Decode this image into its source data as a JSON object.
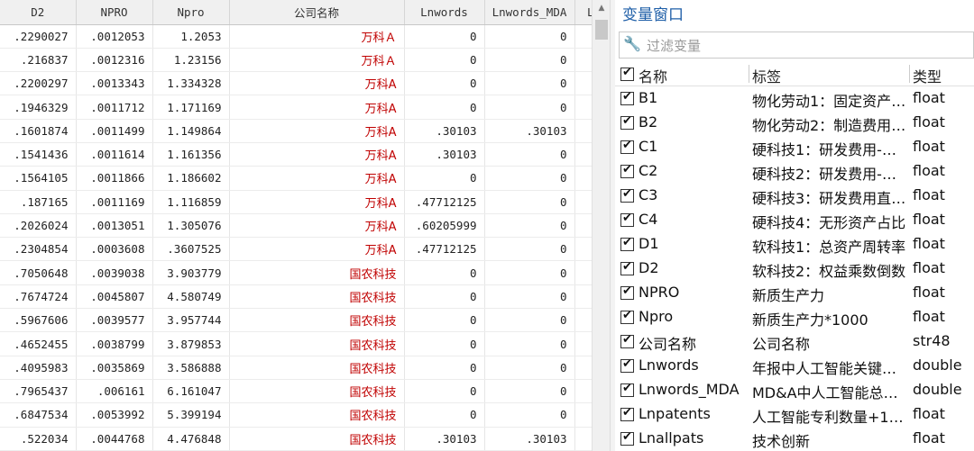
{
  "grid": {
    "columns": [
      "D2",
      "NPRO",
      "Npro",
      "公司名称",
      "Lnwords",
      "Lnwords_MDA",
      "Ln"
    ],
    "rows": [
      [
        ".2290027",
        ".0012053",
        "1.2053",
        "万科Ａ",
        "0",
        "0"
      ],
      [
        ".216837",
        ".0012316",
        "1.23156",
        "万科Ａ",
        "0",
        "0"
      ],
      [
        ".2200297",
        ".0013343",
        "1.334328",
        "万科A",
        "0",
        "0"
      ],
      [
        ".1946329",
        ".0011712",
        "1.171169",
        "万科A",
        "0",
        "0"
      ],
      [
        ".1601874",
        ".0011499",
        "1.149864",
        "万科A",
        ".30103",
        ".30103"
      ],
      [
        ".1541436",
        ".0011614",
        "1.161356",
        "万科A",
        ".30103",
        "0"
      ],
      [
        ".1564105",
        ".0011866",
        "1.186602",
        "万科A",
        "0",
        "0"
      ],
      [
        ".187165",
        ".0011169",
        "1.116859",
        "万科A",
        ".47712125",
        "0"
      ],
      [
        ".2026024",
        ".0013051",
        "1.305076",
        "万科A",
        ".60205999",
        "0"
      ],
      [
        ".2304854",
        ".0003608",
        ".3607525",
        "万科A",
        ".47712125",
        "0"
      ],
      [
        ".7050648",
        ".0039038",
        "3.903779",
        "国农科技",
        "0",
        "0"
      ],
      [
        ".7674724",
        ".0045807",
        "4.580749",
        "国农科技",
        "0",
        "0"
      ],
      [
        ".5967606",
        ".0039577",
        "3.957744",
        "国农科技",
        "0",
        "0"
      ],
      [
        ".4652455",
        ".0038799",
        "3.879853",
        "国农科技",
        "0",
        "0"
      ],
      [
        ".4095983",
        ".0035869",
        "3.586888",
        "国农科技",
        "0",
        "0"
      ],
      [
        ".7965437",
        ".006161",
        "6.161047",
        "国农科技",
        "0",
        "0"
      ],
      [
        ".6847534",
        ".0053992",
        "5.399194",
        "国农科技",
        "0",
        "0"
      ],
      [
        ".522034",
        ".0044768",
        "4.476848",
        "国农科技",
        ".30103",
        ".30103"
      ]
    ]
  },
  "scrollbar": {
    "up_arrow": "▲"
  },
  "variables_window": {
    "title": "变量窗口",
    "filter_placeholder": "过滤变量",
    "wrench_glyph": "🔧",
    "headers": {
      "name": "名称",
      "label": "标签",
      "type": "类型"
    },
    "variables": [
      {
        "name": "B1",
        "label": "物化劳动1：固定资产占...",
        "type": "float"
      },
      {
        "name": "B2",
        "label": "物化劳动2：制造费用占...",
        "type": "float"
      },
      {
        "name": "C1",
        "label": "硬科技1：研发费用-折...",
        "type": "float"
      },
      {
        "name": "C2",
        "label": "硬科技2：研发费用-租...",
        "type": "float"
      },
      {
        "name": "C3",
        "label": "硬科技3：研发费用直接...",
        "type": "float"
      },
      {
        "name": "C4",
        "label": "硬科技4：无形资产占比",
        "type": "float"
      },
      {
        "name": "D1",
        "label": "软科技1：总资产周转率",
        "type": "float"
      },
      {
        "name": "D2",
        "label": "软科技2：权益乘数倒数",
        "type": "float"
      },
      {
        "name": "NPRO",
        "label": "新质生产力",
        "type": "float"
      },
      {
        "name": "Npro",
        "label": "新质生产力*1000",
        "type": "float"
      },
      {
        "name": "公司名称",
        "label": "公司名称",
        "type": "str48"
      },
      {
        "name": "Lnwords",
        "label": "年报中人工智能关键词...",
        "type": "double"
      },
      {
        "name": "Lnwords_MDA",
        "label": "MD&A中人工智能总词...",
        "type": "double"
      },
      {
        "name": "Lnpatents",
        "label": "人工智能专利数量+1后...",
        "type": "float"
      },
      {
        "name": "Lnallpats",
        "label": "技术创新",
        "type": "float"
      }
    ]
  }
}
